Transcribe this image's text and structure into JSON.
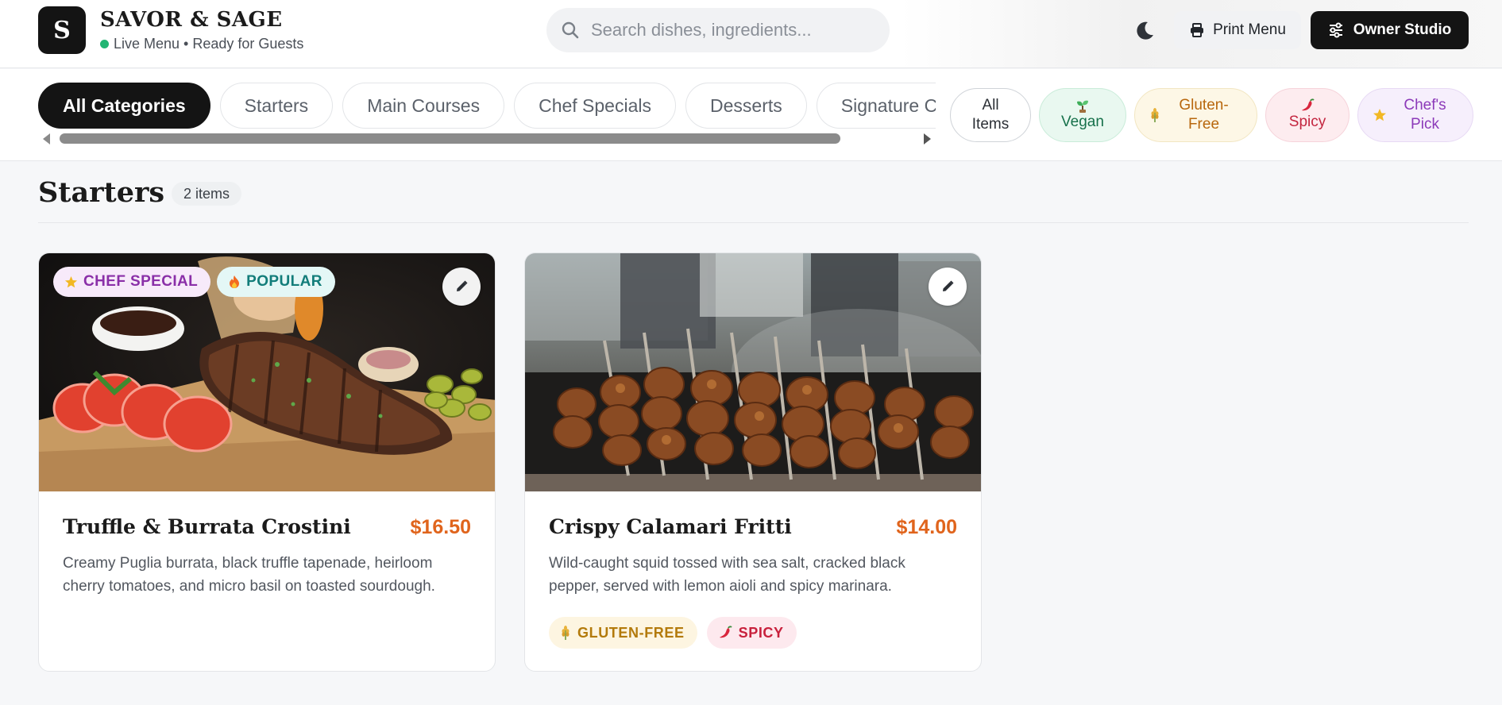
{
  "brand": {
    "logo_letter": "S",
    "name": "SAVOR & SAGE",
    "status": "Live Menu • Ready for Guests"
  },
  "search": {
    "placeholder": "Search dishes, ingredients..."
  },
  "header_actions": {
    "theme_toggle_icon": "moon-icon",
    "print_label": "Print Menu",
    "owner_label": "Owner Studio"
  },
  "categories": [
    {
      "label": "All Categories",
      "active": true
    },
    {
      "label": "Starters",
      "active": false
    },
    {
      "label": "Main Courses",
      "active": false
    },
    {
      "label": "Chef Specials",
      "active": false
    },
    {
      "label": "Desserts",
      "active": false
    },
    {
      "label": "Signature Cocktails",
      "active": false
    }
  ],
  "filters": [
    {
      "label": "All Items",
      "icon": ""
    },
    {
      "label": "Vegan",
      "icon": "sprout-icon"
    },
    {
      "label": "Gluten-Free",
      "icon": "wheat-icon"
    },
    {
      "label": "Spicy",
      "icon": "chili-icon"
    },
    {
      "label": "Chef's Pick",
      "icon": "star-icon"
    }
  ],
  "section": {
    "title": "Starters",
    "count": "2 items"
  },
  "dishes": [
    {
      "name": "Truffle & Burrata Crostini",
      "price": "$16.50",
      "description": "Creamy Puglia burrata, black truffle tapenade, heirloom cherry tomatoes, and micro basil on toasted sourdough.",
      "badges": [
        "CHEF SPECIAL",
        "POPULAR"
      ],
      "tags": []
    },
    {
      "name": "Crispy Calamari Fritti",
      "price": "$14.00",
      "description": "Wild-caught squid tossed with sea salt, cracked black pepper, served with lemon aioli and spicy marinara.",
      "badges": [],
      "tags": [
        "GLUTEN-FREE",
        "SPICY"
      ]
    }
  ],
  "colors": {
    "accent_dark": "#141414",
    "price": "#e0641c",
    "live_dot": "#22b573"
  }
}
